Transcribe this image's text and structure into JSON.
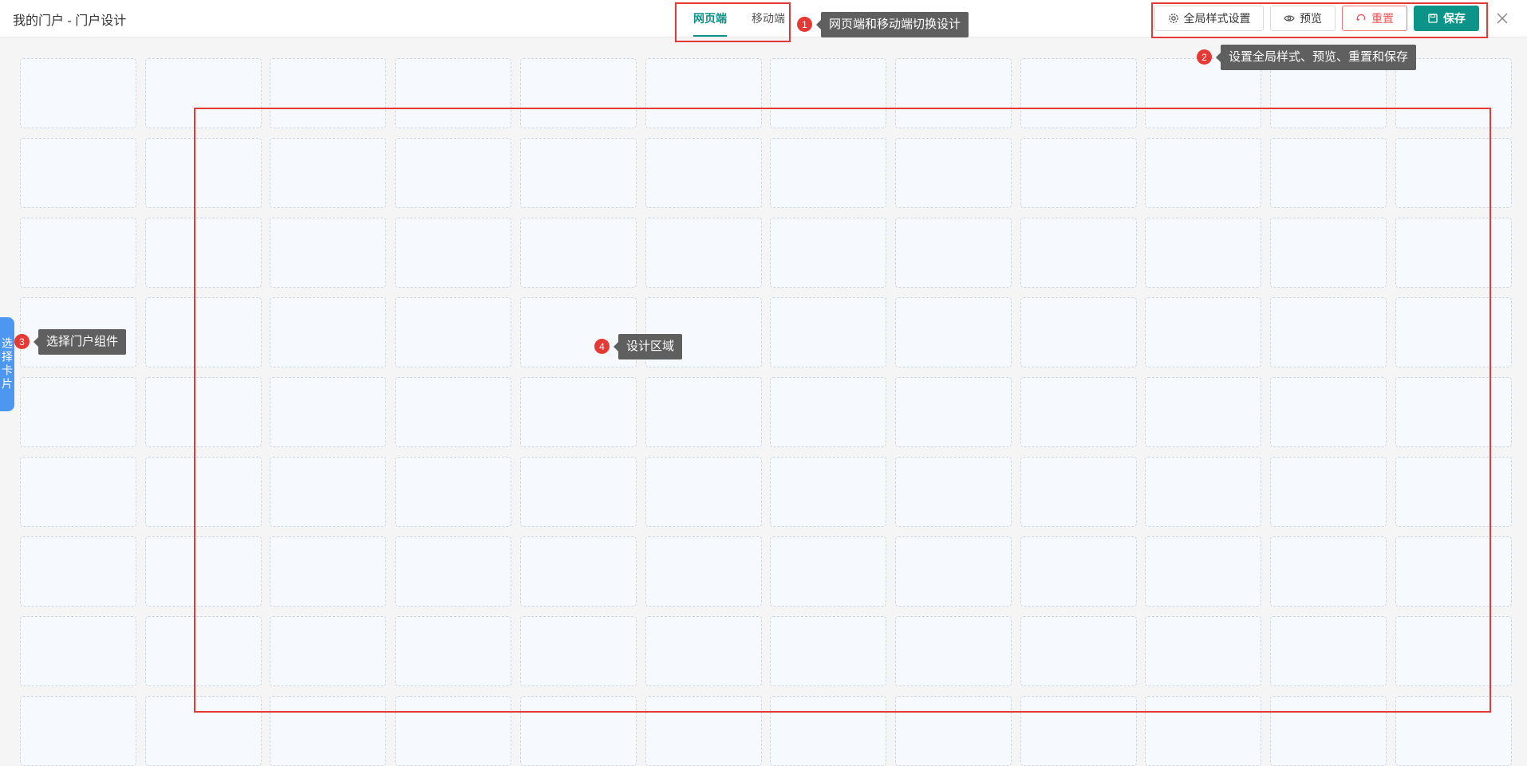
{
  "header": {
    "title": "我的门户 - 门户设计",
    "tabs": [
      "网页端",
      "移动端"
    ],
    "active_tab": "网页端",
    "buttons": {
      "global_style": "全局样式设置",
      "preview": "预览",
      "reset": "重置",
      "save": "保存"
    }
  },
  "sidebar": {
    "pick_card": "选择卡片"
  },
  "annotations": [
    {
      "number": "1",
      "text": "网页端和移动端切换设计"
    },
    {
      "number": "2",
      "text": "设置全局样式、预览、重置和保存"
    },
    {
      "number": "3",
      "text": "选择门户组件"
    },
    {
      "number": "4",
      "text": "设计区域"
    }
  ],
  "colors": {
    "accent": "#0d9488",
    "annotation_red": "#e53935",
    "side_tab_blue": "#4e97f0",
    "tooltip_gray": "#5f5f5f"
  }
}
